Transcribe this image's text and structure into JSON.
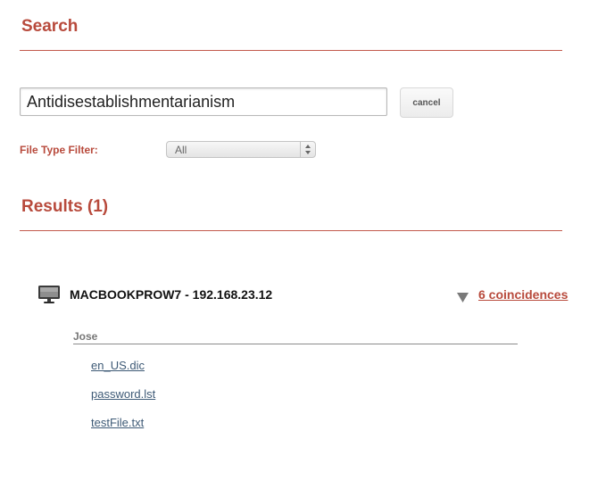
{
  "search": {
    "title": "Search",
    "query": "Antidisestablishmentarianism",
    "cancel_label": "cancel",
    "filter_label": "File Type Filter:",
    "filter_value": "All"
  },
  "results": {
    "title": "Results (1)",
    "host": {
      "name": "MACBOOKPROW7 - 192.168.23.12",
      "coincidences_label": "6 coincidences",
      "user": "Jose",
      "files": [
        "en_US.dic",
        "password.lst",
        "testFile.txt"
      ]
    }
  },
  "icons": {
    "host": "computer-icon",
    "toggle": "triangle-down-icon",
    "select": "up-down-arrows-icon"
  },
  "colors": {
    "accent": "#b84a3c",
    "link": "#3e5a76"
  }
}
